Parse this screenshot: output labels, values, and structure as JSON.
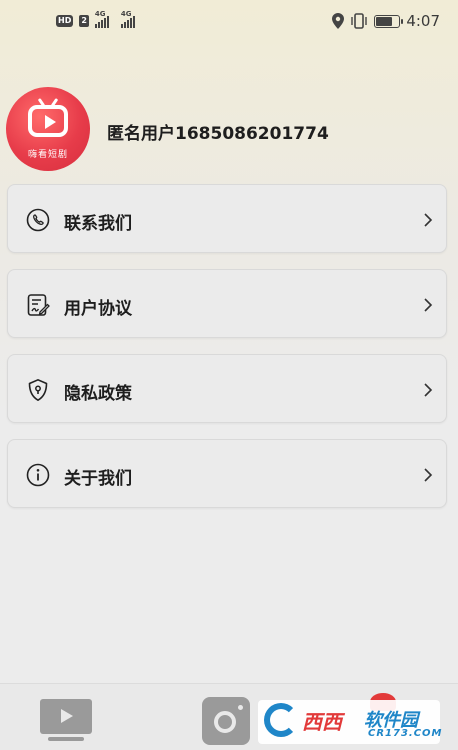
{
  "status_bar": {
    "hd": "HD",
    "sim": "2",
    "net1": "4G",
    "net2": "4G",
    "time": "4:07",
    "battery_percent": 75
  },
  "profile": {
    "avatar_tag": "嗨看短剧",
    "username": "匿名用户1685086201774"
  },
  "menu": {
    "items": [
      {
        "label": "联系我们",
        "icon": "phone-icon"
      },
      {
        "label": "用户协议",
        "icon": "document-sign-icon"
      },
      {
        "label": "隐私政策",
        "icon": "shield-icon"
      },
      {
        "label": "关于我们",
        "icon": "info-icon"
      }
    ]
  },
  "bottom_nav": {
    "items": [
      {
        "icon": "video-play-icon"
      },
      {
        "icon": "camera-icon"
      }
    ]
  },
  "watermark": {
    "text_cn1": "西西",
    "text_cn2": "软件园",
    "text_en": "CR173.COM"
  }
}
